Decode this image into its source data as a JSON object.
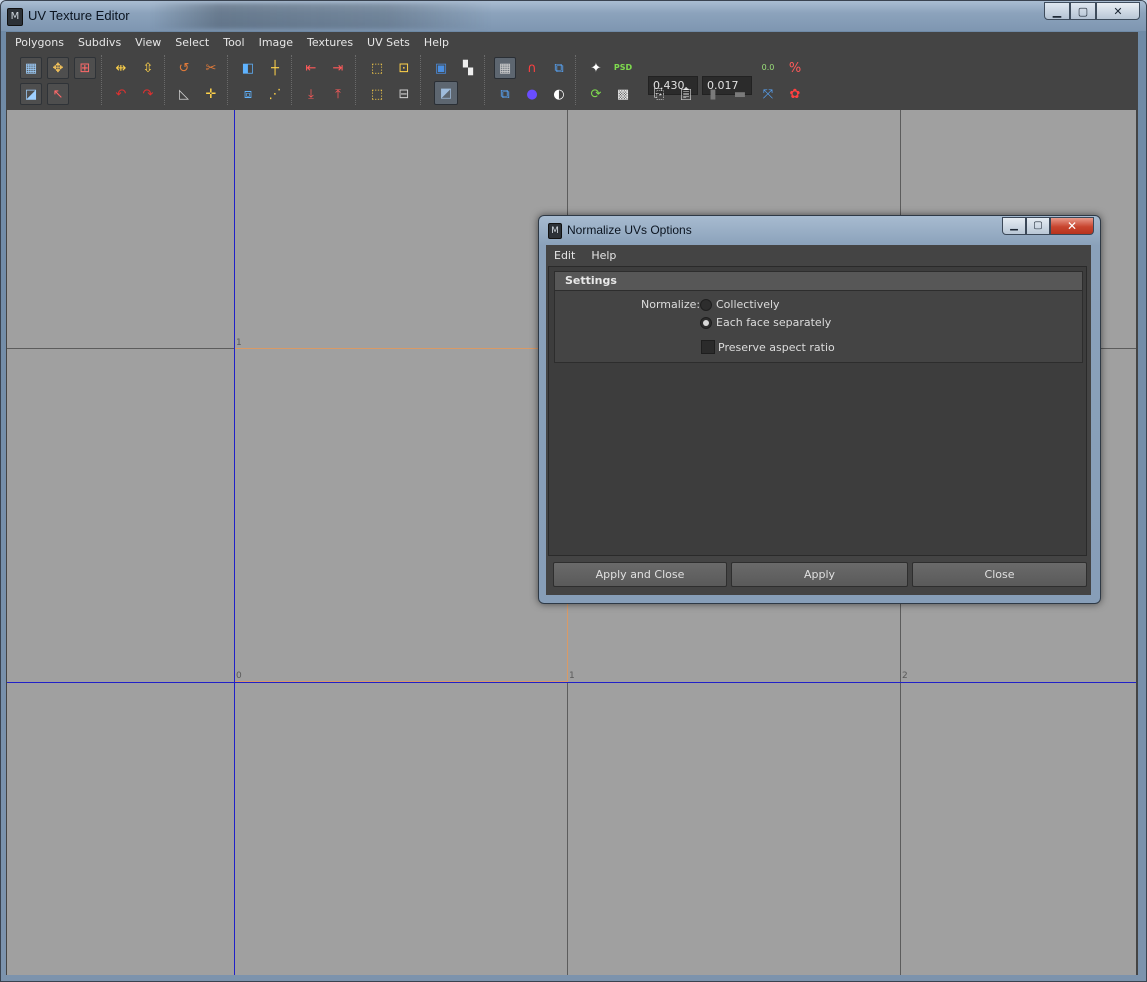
{
  "window": {
    "title": "UV Texture Editor",
    "controls": {
      "minimize": "▁",
      "maximize": "▢",
      "close": "✕"
    }
  },
  "menu": [
    "Polygons",
    "Subdivs",
    "View",
    "Select",
    "Tool",
    "Image",
    "Textures",
    "UV Sets",
    "Help"
  ],
  "toolbar": {
    "u_value": "0.430",
    "v_value": "0.017",
    "zero_label": "0.0",
    "psd_label": "PSD"
  },
  "viewport": {
    "grid_labels": [
      "1",
      "0",
      "1",
      "2"
    ],
    "colors": {
      "grid": "#5c5c5c",
      "axis": "#2020c8",
      "uv_border": "#d99a66",
      "background": "#a0a0a0"
    }
  },
  "dialog": {
    "title": "Normalize UVs Options",
    "menu": [
      "Edit",
      "Help"
    ],
    "section": "Settings",
    "normalize_label": "Normalize:",
    "options": [
      {
        "label": "Collectively",
        "selected": false
      },
      {
        "label": "Each face separately",
        "selected": true
      }
    ],
    "preserve_aspect": {
      "label": "Preserve aspect ratio",
      "checked": false
    },
    "buttons": {
      "apply_close": "Apply and Close",
      "apply": "Apply",
      "close": "Close"
    }
  }
}
